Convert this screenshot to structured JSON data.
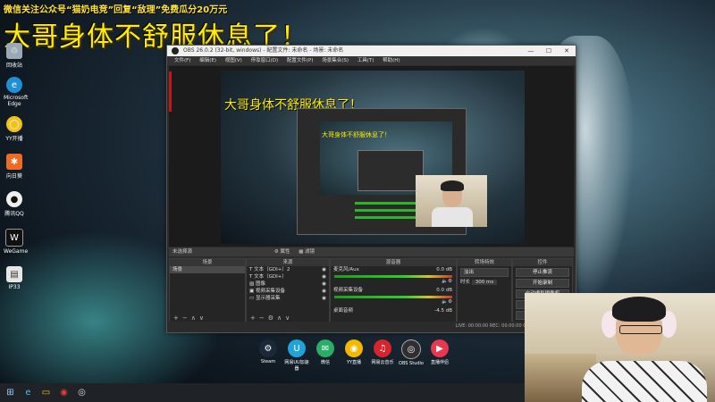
{
  "overlay": {
    "banner": "微信关注公众号“猫奶电竞”回复“敌理”免费瓜分20万元",
    "title": "大哥身体不舒服休息了！"
  },
  "desktop_icons": [
    {
      "label": "回收站",
      "icon": "recycle-bin-icon"
    },
    {
      "label": "Microsoft Edge",
      "icon": "edge-icon"
    },
    {
      "label": "YY开播",
      "icon": "yy-icon"
    },
    {
      "label": "向日葵",
      "icon": "sunflower-icon"
    },
    {
      "label": "腾讯QQ",
      "icon": "qq-icon"
    },
    {
      "label": "WeGame",
      "icon": "wegame-icon"
    },
    {
      "label": "IP33",
      "icon": "file-icon"
    }
  ],
  "obs": {
    "title": "OBS 26.0.2 (32-bit, windows) - 配置文件: 未命名 - 场景: 未命名",
    "menu": [
      "文件(F)",
      "编辑(E)",
      "视图(V)",
      "停靠窗口(D)",
      "配置文件(P)",
      "场景集合(S)",
      "工具(T)",
      "帮助(H)"
    ],
    "nested_title": "大哥身体不舒服休息了！",
    "scene_label": "未选择源",
    "props_btn": "属性",
    "filters_btn": "滤镜",
    "docks": {
      "scenes": {
        "header": "场景",
        "items": [
          "场景"
        ]
      },
      "sources": {
        "header": "来源",
        "items": [
          "文本（GDI+）2",
          "文本（GDI+）",
          "图像",
          "视频采集设备",
          "显示器采集"
        ]
      },
      "mixer": {
        "header": "混音器",
        "channels": [
          {
            "name": "麦克风/Aux",
            "db": "0.0 dB"
          },
          {
            "name": "视频采集设备",
            "db": "0.0 dB"
          },
          {
            "name": "桌面音频",
            "db": "-4.5 dB"
          }
        ]
      },
      "transitions": {
        "header": "转场特效",
        "mode": "淡出",
        "duration_label": "时长",
        "duration": "300 ms"
      },
      "controls": {
        "header": "控件",
        "buttons": [
          "停止推流",
          "开始录制",
          "启动虚拟摄像机",
          "工作室模式",
          "设置",
          "退出"
        ]
      }
    },
    "status": "LIVE: 00:00:00   REC: 00:00:00   CPU: 0.3%, 30.00 fps"
  },
  "apps": [
    {
      "label": "Steam",
      "icon": "steam-icon",
      "color": "#1b2838"
    },
    {
      "label": "网易UU加速器",
      "icon": "uu-icon",
      "color": "#1fa3d9"
    },
    {
      "label": "微信",
      "icon": "wechat-icon",
      "color": "#2aae67"
    },
    {
      "label": "YY直播",
      "icon": "yy-icon",
      "color": "#f5b800"
    },
    {
      "label": "网易云音乐",
      "icon": "netease-music-icon",
      "color": "#d6252d"
    },
    {
      "label": "OBS Studio",
      "icon": "obs-icon",
      "color": "#302e31"
    },
    {
      "label": "直播伴侣",
      "icon": "live-companion-icon",
      "color": "#e8384f"
    }
  ]
}
